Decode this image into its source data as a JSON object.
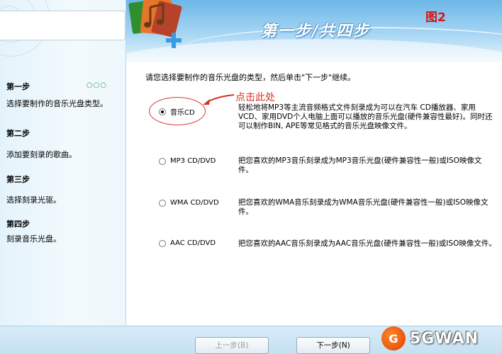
{
  "header": {
    "step_text": "第一步/共四步",
    "figure_label": "图2"
  },
  "sidebar": {
    "progress_dots": "○○○",
    "steps": [
      {
        "title": "第一步",
        "desc": "选择要制作的音乐光盘类型。"
      },
      {
        "title": "第二步",
        "desc": "添加要刻录的歌曲。"
      },
      {
        "title": "第三步",
        "desc": "选择刻录光驱。"
      },
      {
        "title": "第四步",
        "desc": "刻录音乐光盘。"
      }
    ]
  },
  "main": {
    "instruction": "请您选择要制作的音乐光盘的类型，然后单击\"下一步\"继续。",
    "annotation": "点击此处",
    "options": [
      {
        "label": "音乐CD",
        "checked": true,
        "desc": "轻松地将MP3等主流音频格式文件刻录成为可以在汽车 CD播放器、家用VCD、家用DVD个人电脑上面可以播放的音乐光盘(硬件兼容性最好)。同时还可以制作BIN, APE等常见格式的音乐光盘映像文件。"
      },
      {
        "label": "MP3 CD/DVD",
        "checked": false,
        "desc": "把您喜欢的MP3音乐刻录成为MP3音乐光盘(硬件兼容性一般)或ISO映像文件。"
      },
      {
        "label": "WMA CD/DVD",
        "checked": false,
        "desc": "把您喜欢的WMA音乐刻录成为WMA音乐光盘(硬件兼容性一般)或ISO映像文件。"
      },
      {
        "label": "AAC CD/DVD",
        "checked": false,
        "desc": "把您喜欢的AAC音乐刻录成为AAC音乐光盘(硬件兼容性一般)或ISO映像文件。"
      }
    ]
  },
  "footer": {
    "prev_label": "上一步(B)",
    "next_label": "下一步(N)"
  },
  "watermark": {
    "text": "5GWAN",
    "logo_letter": "G"
  },
  "colors": {
    "annotation_red": "#d53227",
    "dots_green": "#34a546",
    "header_blue": "#6cb7e8"
  }
}
